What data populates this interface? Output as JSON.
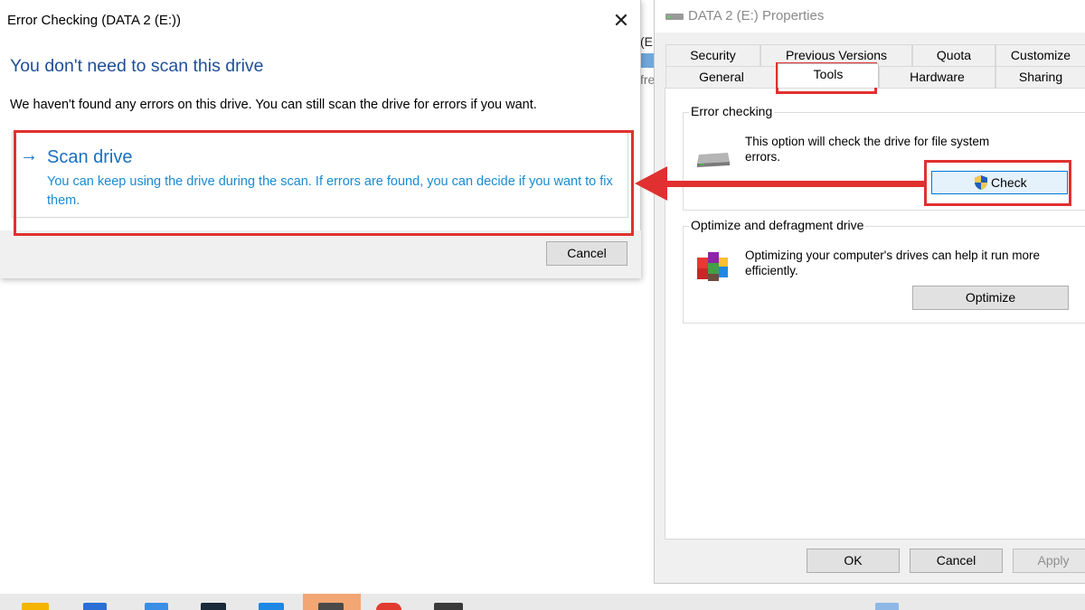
{
  "properties": {
    "title": "DATA 2 (E:) Properties",
    "tabs_row1": [
      "Security",
      "Previous Versions",
      "Quota",
      "Customize"
    ],
    "tabs_row2": [
      "General",
      "Tools",
      "Hardware",
      "Sharing"
    ],
    "active_tab": "Tools",
    "error_checking": {
      "label": "Error checking",
      "description": "This option will check the drive for file system errors.",
      "button": "Check",
      "icon": "drive-icon",
      "button_icon": "uac-shield-icon"
    },
    "optimize": {
      "label": "Optimize and defragment drive",
      "description": "Optimizing your computer's drives can help it run more efficiently.",
      "button": "Optimize",
      "icon": "defrag-icon"
    },
    "footer": {
      "ok": "OK",
      "cancel": "Cancel",
      "apply": "Apply"
    }
  },
  "behind_text": {
    "line1": "(E:",
    "line2": "fre"
  },
  "error_dialog": {
    "title": "Error Checking (DATA 2 (E:))",
    "close": "✕",
    "heading": "You don't need to scan this drive",
    "message": "We haven't found any errors on this drive. You can still scan the drive for errors if you want.",
    "scan_option": {
      "arrow": "→",
      "title": "Scan drive",
      "description": "You can keep using the drive during the scan. If errors are found, you can decide if you want to fix them."
    },
    "cancel": "Cancel"
  },
  "colors": {
    "annotation": "#e03030",
    "heading_blue": "#1f4e99",
    "link_blue": "#1a6fbf"
  }
}
